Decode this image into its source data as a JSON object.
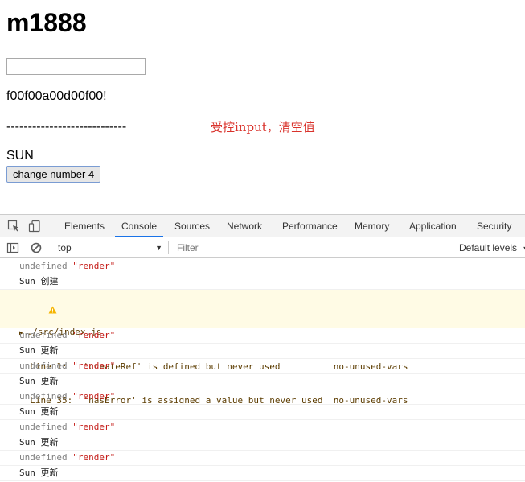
{
  "page": {
    "title": "m1888",
    "input_value": "",
    "echo_text": "f00f00a00d00f00!",
    "dashes": "----------------------------",
    "annotation": "受控input，清空值",
    "sun_text": "SUN",
    "change_button_label": "change number 4"
  },
  "devtools": {
    "tabs": [
      "Elements",
      "Console",
      "Sources",
      "Network",
      "Performance",
      "Memory",
      "Application",
      "Security"
    ],
    "active_tab": "Console",
    "context": "top",
    "filter_placeholder": "Filter",
    "levels_label": "Default levels",
    "console": {
      "render_undefined": "undefined",
      "render_string": "\"render\"",
      "sun_created": "Sun 创建",
      "sun_updated": "Sun 更新",
      "warning": {
        "file": "./src/index.js",
        "line1": "Line 1:   'createRef' is defined but never used          no-unused-vars",
        "line2": "Line 35:  'hasError' is assigned a value but never used  no-unused-vars"
      }
    },
    "colors": {
      "accent": "#1a73e8",
      "warning_bg": "#fffbe5",
      "string": "#c41a16",
      "annotation": "#d9322b"
    }
  }
}
